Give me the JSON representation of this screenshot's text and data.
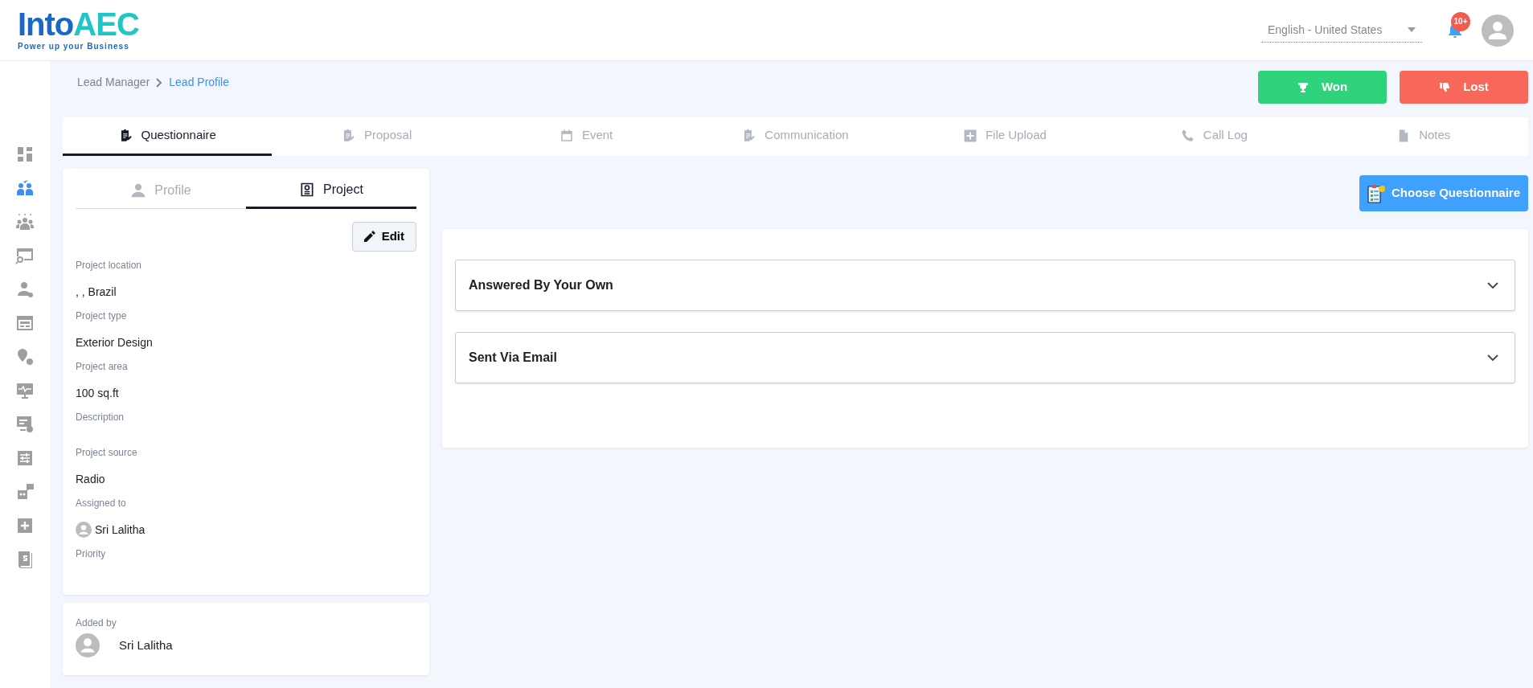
{
  "header": {
    "logo_text": "Into",
    "logo_accent": "AEC",
    "tagline": "Power up your Business",
    "language": "English - United States",
    "notification_count": "10+"
  },
  "sidebar": {
    "items": [
      {
        "selected": false
      },
      {
        "selected": true
      },
      {
        "selected": false
      },
      {
        "selected": false
      },
      {
        "selected": false
      },
      {
        "selected": false
      },
      {
        "selected": false
      },
      {
        "selected": false
      },
      {
        "selected": false
      },
      {
        "selected": false
      },
      {
        "selected": false
      },
      {
        "selected": false
      },
      {
        "selected": false
      }
    ]
  },
  "breadcrumb": [
    {
      "label": "Lead Manager",
      "current": false
    },
    {
      "label": "Lead Profile",
      "current": true
    }
  ],
  "actions": [
    {
      "label": "Won",
      "kind": "won"
    },
    {
      "label": "Lost",
      "kind": "lost"
    }
  ],
  "tabs": [
    {
      "label": "Questionnaire",
      "selected": true
    },
    {
      "label": "Proposal",
      "selected": false
    },
    {
      "label": "Event",
      "selected": false
    },
    {
      "label": "Communication",
      "selected": false
    },
    {
      "label": "File Upload",
      "selected": false
    },
    {
      "label": "Call Log",
      "selected": false
    },
    {
      "label": "Notes",
      "selected": false
    }
  ],
  "details": {
    "tabs": [
      {
        "label": "Profile",
        "selected": false
      },
      {
        "label": "Project",
        "selected": true
      }
    ],
    "edit_button": "Edit",
    "fields": [
      {
        "label": "Project location",
        "value": ", , Brazil"
      },
      {
        "label": "Project type",
        "value": "Exterior Design"
      },
      {
        "label": "Project area",
        "value": "100 sq.ft"
      },
      {
        "label": "Description"
      },
      {
        "label": "Project source",
        "value": "Radio"
      },
      {
        "label": "Assigned to",
        "value": "Sri Lalitha",
        "kind": "person"
      },
      {
        "label": "Priority"
      }
    ]
  },
  "added_by": {
    "label": "Added by",
    "name": "Sri Lalitha"
  },
  "choose_button": "Choose Questionnaire",
  "accordion": [
    {
      "title": "Answered By Your Own",
      "expanded": false
    },
    {
      "title": "Sent Via Email",
      "expanded": false
    }
  ]
}
